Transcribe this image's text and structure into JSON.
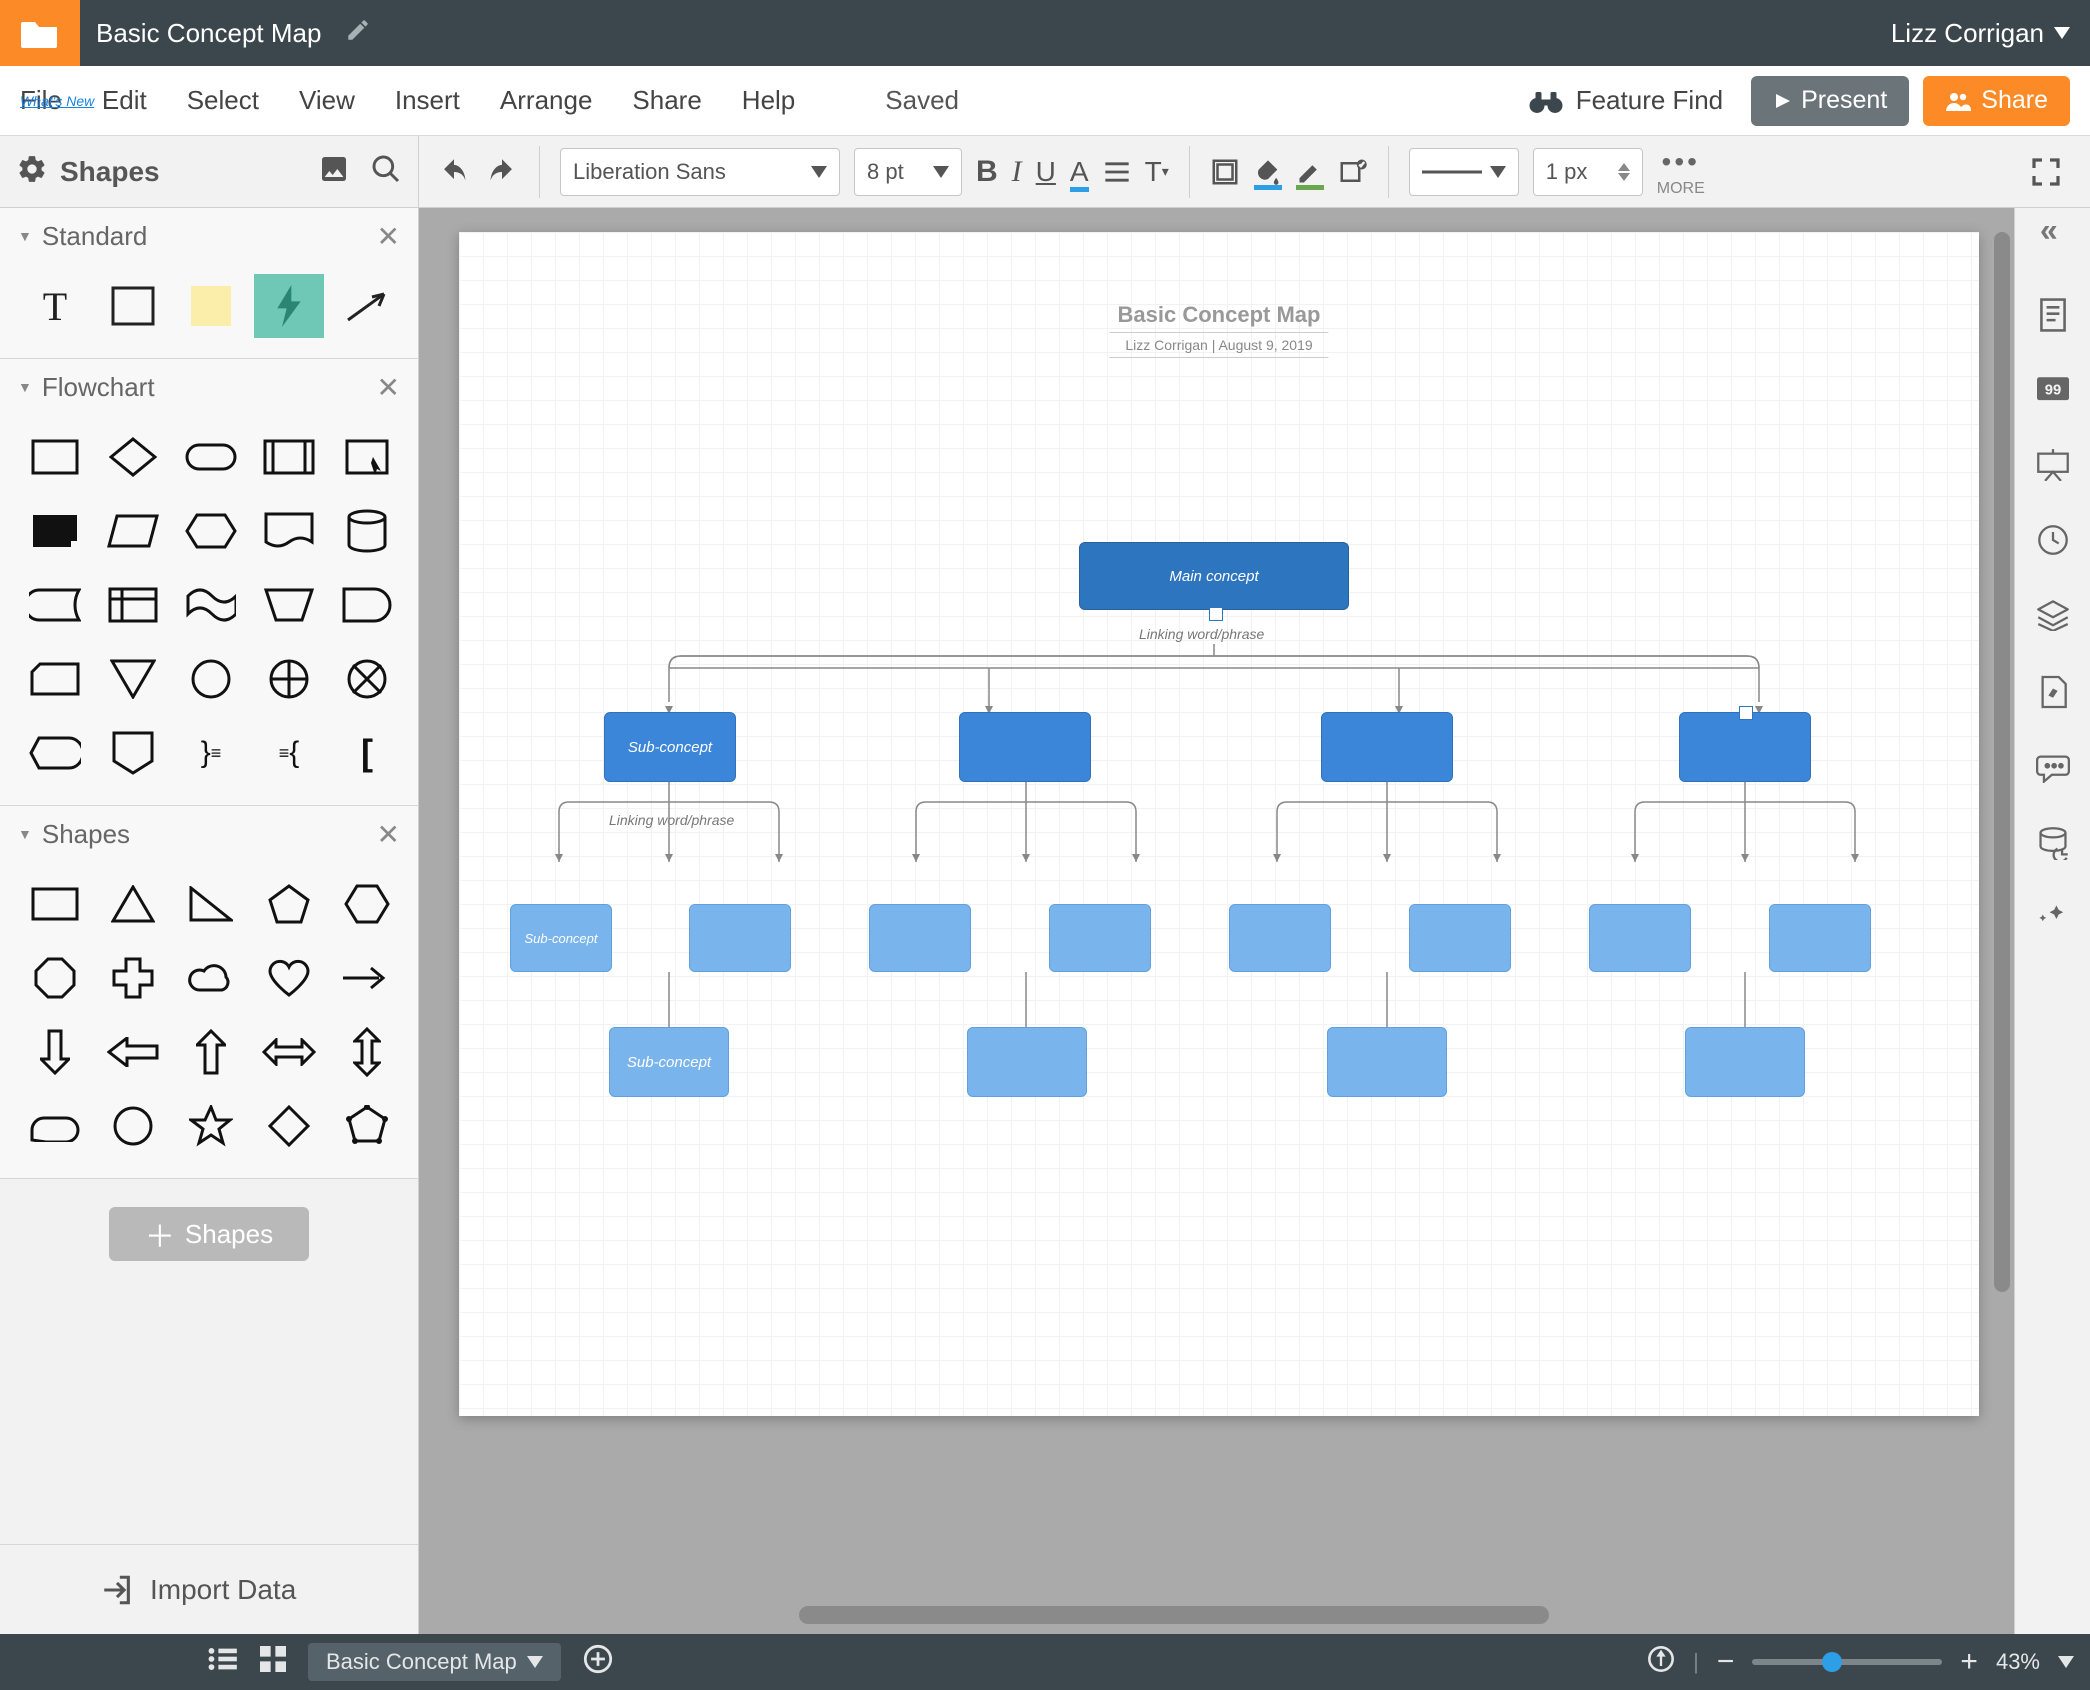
{
  "appbar": {
    "title": "Basic Concept Map",
    "user": "Lizz Corrigan"
  },
  "menu": {
    "file": "File",
    "edit": "Edit",
    "select": "Select",
    "view": "View",
    "insert": "Insert",
    "arrange": "Arrange",
    "share": "Share",
    "help": "Help",
    "whatsnew": "What's New",
    "saved": "Saved",
    "feature": "Feature Find",
    "present": "Present",
    "sharebtn": "Share"
  },
  "toolbar": {
    "shapes": "Shapes",
    "font": "Liberation Sans",
    "fontsize": "8 pt",
    "linewidth": "1 px",
    "more": "MORE"
  },
  "panel": {
    "cat1": "Standard",
    "cat2": "Flowchart",
    "cat3": "Shapes",
    "add": "Shapes",
    "import": "Import Data"
  },
  "diagram": {
    "title": "Basic Concept Map",
    "subtitle": "Lizz Corrigan  |  August 9, 2019",
    "main": "Main concept",
    "link1": "Linking word/phrase",
    "sub": "Sub-concept",
    "link2": "Linking word/phrase",
    "leafsub": "Sub-concept",
    "leafsub2": "Sub-concept"
  },
  "bottom": {
    "page": "Basic Concept Map",
    "zoom": "43%"
  }
}
